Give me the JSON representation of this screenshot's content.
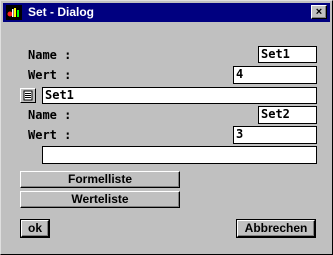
{
  "window": {
    "title": "Set - Dialog",
    "close_label": "×"
  },
  "set1": {
    "name_label": "Name :",
    "name_value": "Set1",
    "wert_label": "Wert :",
    "wert_value": "4",
    "list_value": "Set1"
  },
  "set2": {
    "name_label": "Name :",
    "name_value": "Set2",
    "wert_label": "Wert :",
    "wert_value": "3",
    "list_value": ""
  },
  "buttons": {
    "formelliste": "Formelliste",
    "werteliste": "Werteliste",
    "ok": "ok",
    "abbrechen": "Abbrechen"
  }
}
